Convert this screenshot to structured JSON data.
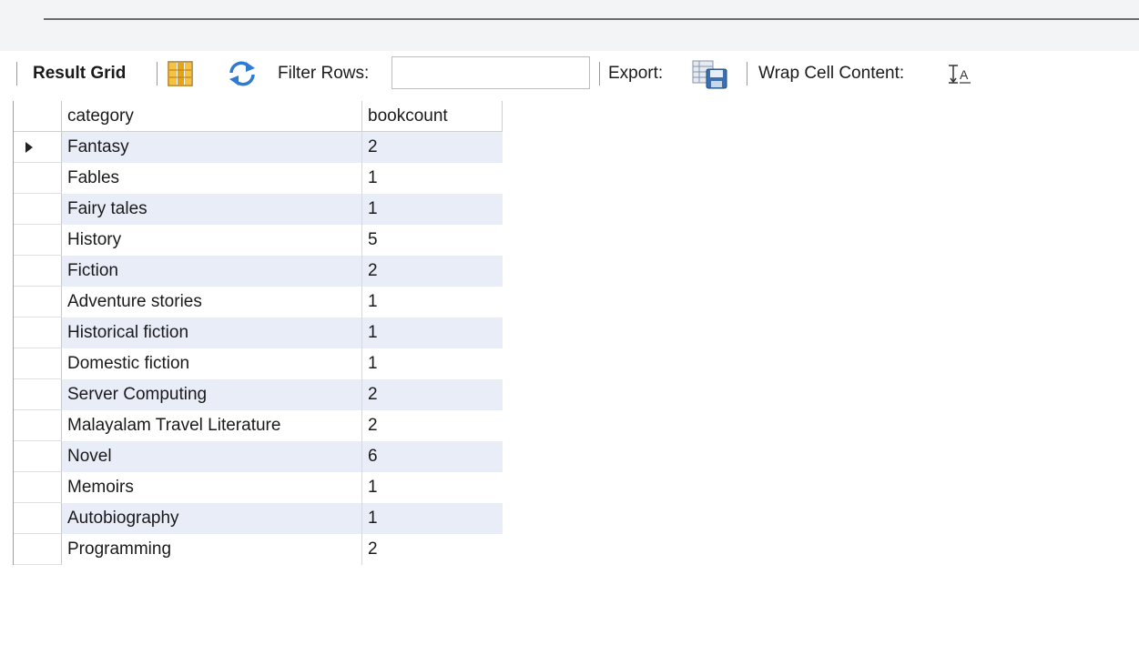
{
  "toolbar": {
    "result_grid_label": "Result Grid",
    "filter_label": "Filter Rows:",
    "filter_value": "",
    "export_label": "Export:",
    "wrap_label": "Wrap Cell Content:",
    "icons": [
      "grid-layout-icon",
      "refresh-icon",
      "export-icon",
      "wrap-cell-icon"
    ]
  },
  "grid": {
    "columns": [
      "category",
      "bookcount"
    ],
    "selected_row": 0,
    "rows": [
      {
        "category": "Fantasy",
        "bookcount": "2"
      },
      {
        "category": "Fables",
        "bookcount": "1"
      },
      {
        "category": "Fairy tales",
        "bookcount": "1"
      },
      {
        "category": "History",
        "bookcount": "5"
      },
      {
        "category": "Fiction",
        "bookcount": "2"
      },
      {
        "category": "Adventure stories",
        "bookcount": "1"
      },
      {
        "category": "Historical fiction",
        "bookcount": "1"
      },
      {
        "category": "Domestic fiction",
        "bookcount": "1"
      },
      {
        "category": "Server Computing",
        "bookcount": "2"
      },
      {
        "category": "Malayalam Travel Literature",
        "bookcount": "2"
      },
      {
        "category": "Novel",
        "bookcount": "6"
      },
      {
        "category": "Memoirs",
        "bookcount": "1"
      },
      {
        "category": "Autobiography",
        "bookcount": "1"
      },
      {
        "category": "Programming",
        "bookcount": "2"
      }
    ]
  },
  "colors": {
    "alt_row": "#e9edf8",
    "refresh_icon": "#2e7bd6",
    "grid_icon": "#e8a317"
  }
}
